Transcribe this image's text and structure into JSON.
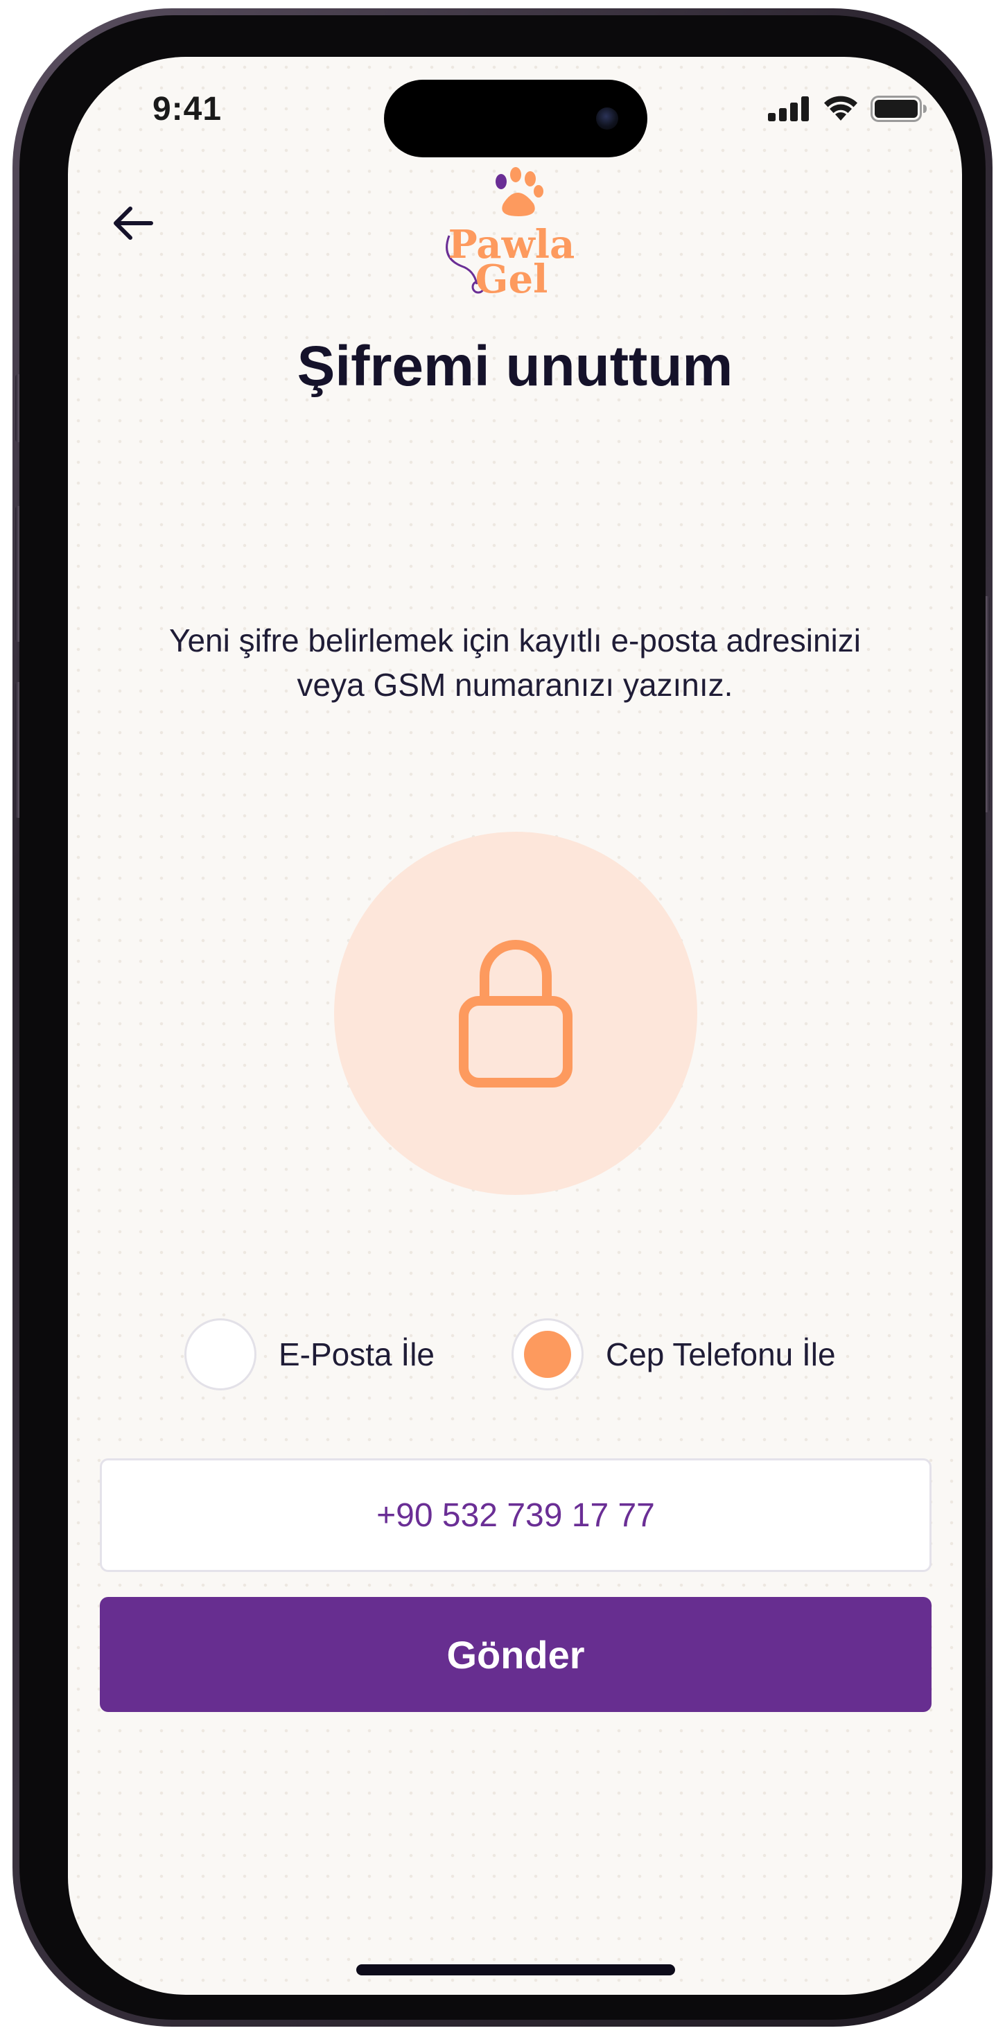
{
  "status_bar": {
    "time": "9:41",
    "icons": [
      "cellular-signal-icon",
      "wifi-icon",
      "battery-icon"
    ]
  },
  "header": {
    "back_icon": "arrow-left-icon",
    "logo": {
      "line1": "Pawla",
      "line2": "Gel",
      "icon": "paw-print-icon"
    }
  },
  "page": {
    "title": "Şifremi unuttum",
    "description": "Yeni şifre belirlemek için kayıtlı e-posta adresinizi veya GSM numaranızı yazınız.",
    "illustration_icon": "lock-icon"
  },
  "recovery_method": {
    "options": [
      {
        "label": "E-Posta İle",
        "selected": false
      },
      {
        "label": "Cep Telefonu İle",
        "selected": true
      }
    ]
  },
  "form": {
    "phone_value": "+90 532 739 17 77",
    "submit_label": "Gönder"
  },
  "colors": {
    "brand_purple": "#672e90",
    "accent_orange": "#fd9a5e",
    "lock_circle_bg": "#fde6da",
    "screen_bg": "#faf8f5",
    "title_text": "#15122a"
  }
}
